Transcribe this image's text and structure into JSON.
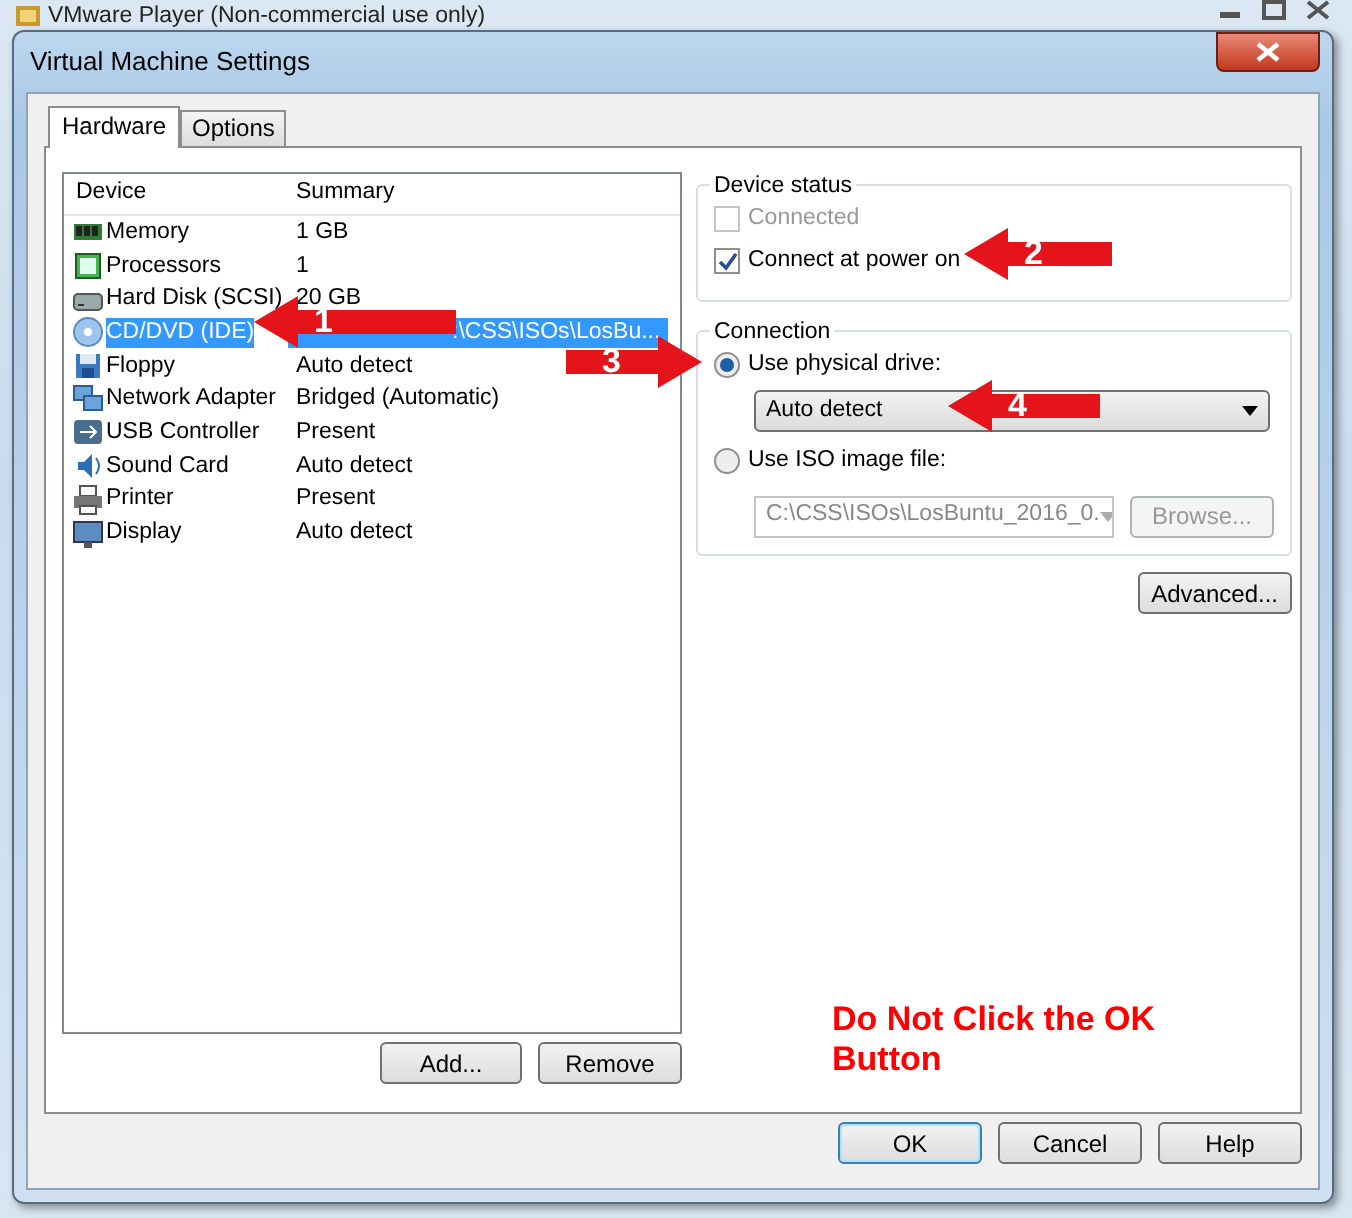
{
  "background_window": {
    "title": "VMware Player (Non-commercial use only)"
  },
  "dialog": {
    "title": "Virtual Machine Settings"
  },
  "tabs": [
    {
      "label": "Hardware",
      "selected": true
    },
    {
      "label": "Options",
      "selected": false
    }
  ],
  "device_table": {
    "columns": [
      "Device",
      "Summary"
    ],
    "rows": [
      {
        "device": "Memory",
        "summary": "1 GB",
        "selected": false
      },
      {
        "device": "Processors",
        "summary": "1",
        "selected": false
      },
      {
        "device": "Hard Disk (SCSI)",
        "summary": "20 GB",
        "selected": false
      },
      {
        "device": "CD/DVD (IDE)",
        "summary": ":\\CSS\\ISOs\\LosBu...",
        "selected": true
      },
      {
        "device": "Floppy",
        "summary": "Auto detect",
        "selected": false
      },
      {
        "device": "Network Adapter",
        "summary": "Bridged (Automatic)",
        "selected": false
      },
      {
        "device": "USB Controller",
        "summary": "Present",
        "selected": false
      },
      {
        "device": "Sound Card",
        "summary": "Auto detect",
        "selected": false
      },
      {
        "device": "Printer",
        "summary": "Present",
        "selected": false
      },
      {
        "device": "Display",
        "summary": "Auto detect",
        "selected": false
      }
    ]
  },
  "list_buttons": [
    "Add...",
    "Remove"
  ],
  "device_status": {
    "title": "Device status",
    "options": [
      {
        "label": "Connected",
        "checked": false,
        "disabled": true
      },
      {
        "label": "Connect at power on",
        "checked": true,
        "disabled": false
      }
    ]
  },
  "connection": {
    "title": "Connection",
    "physical": {
      "label": "Use physical drive:",
      "selected": true,
      "drive": "Auto detect"
    },
    "iso": {
      "label": "Use ISO image file:",
      "selected": false,
      "path": "C:\\CSS\\ISOs\\LosBuntu_2016_0.",
      "browse": "Browse...",
      "disabled": true
    }
  },
  "advanced_button": "Advanced...",
  "note": "Do Not Click the OK Button",
  "dialog_buttons": [
    {
      "label": "OK",
      "default": true
    },
    {
      "label": "Cancel",
      "default": false
    },
    {
      "label": "Help",
      "default": false
    }
  ],
  "annotations": [
    {
      "label": "1",
      "kind": "left"
    },
    {
      "label": "2",
      "kind": "left"
    },
    {
      "label": "3",
      "kind": "right"
    },
    {
      "label": "4",
      "kind": "left"
    }
  ]
}
